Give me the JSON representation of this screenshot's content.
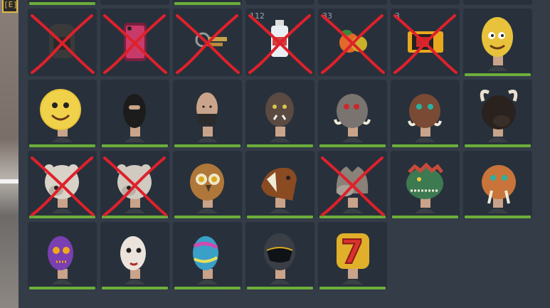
{
  "key_hint": "[E]",
  "inventory": {
    "slots": [
      {
        "kind": "unknown",
        "icon": "unknown-item-icon",
        "count": "",
        "crossed": false,
        "bar": true
      },
      {
        "kind": "unknown",
        "icon": "unknown-item-icon",
        "count": "",
        "crossed": false,
        "bar": false
      },
      {
        "kind": "unknown",
        "icon": "unknown-item-icon",
        "count": "",
        "crossed": false,
        "bar": true
      },
      {
        "kind": "unknown",
        "icon": "unknown-item-icon",
        "count": "",
        "crossed": false,
        "bar": false
      },
      {
        "kind": "unknown",
        "icon": "unknown-item-icon",
        "count": "",
        "crossed": false,
        "bar": false
      },
      {
        "kind": "unknown",
        "icon": "unknown-item-icon",
        "count": "",
        "crossed": false,
        "bar": false
      },
      {
        "kind": "unknown",
        "icon": "unknown-item-icon",
        "count": "",
        "crossed": false,
        "bar": false
      },
      {
        "kind": "backpack",
        "icon": "backpack-icon",
        "count": "",
        "crossed": true,
        "bar": false
      },
      {
        "kind": "phone",
        "icon": "phone-icon",
        "count": "",
        "crossed": true,
        "bar": false
      },
      {
        "kind": "keys",
        "icon": "keys-icon",
        "count": "",
        "crossed": true,
        "bar": false
      },
      {
        "kind": "bottle",
        "icon": "water-bottle-icon",
        "count": "112",
        "crossed": true,
        "bar": false
      },
      {
        "kind": "fruit",
        "icon": "fruit-icon",
        "count": "33",
        "crossed": true,
        "bar": false
      },
      {
        "kind": "ticket",
        "icon": "ticket-icon",
        "count": "3",
        "crossed": true,
        "bar": false
      },
      {
        "kind": "mask",
        "icon": "pineapple-mask-icon",
        "color": "#e7c23a",
        "count": "",
        "crossed": false,
        "bar": true
      },
      {
        "kind": "mask",
        "icon": "lemon-face-mask-icon",
        "color": "#f0d24a",
        "count": "",
        "crossed": false,
        "bar": true
      },
      {
        "kind": "mask",
        "icon": "balaclava-mask-icon",
        "color": "#1c1c1c",
        "count": "",
        "crossed": false,
        "bar": true
      },
      {
        "kind": "mask",
        "icon": "bandana-mask-icon",
        "color": "#2b2b2b",
        "count": "",
        "crossed": false,
        "bar": true
      },
      {
        "kind": "mask",
        "icon": "orc-mask-icon",
        "color": "#5a4a42",
        "count": "",
        "crossed": false,
        "bar": true
      },
      {
        "kind": "mask",
        "icon": "warthog-mask-icon",
        "color": "#7a7470",
        "count": "",
        "crossed": false,
        "bar": true
      },
      {
        "kind": "mask",
        "icon": "boar-mask-icon",
        "color": "#7a4a35",
        "count": "",
        "crossed": false,
        "bar": true
      },
      {
        "kind": "mask",
        "icon": "bull-mask-icon",
        "color": "#2a221e",
        "count": "",
        "crossed": false,
        "bar": true
      },
      {
        "kind": "mask",
        "icon": "bear-mask-icon",
        "color": "#d8d2c8",
        "count": "",
        "crossed": true,
        "bar": true
      },
      {
        "kind": "mask",
        "icon": "bear-mask-icon",
        "color": "#d0cac0",
        "count": "",
        "crossed": true,
        "bar": true
      },
      {
        "kind": "mask",
        "icon": "owl-mask-icon",
        "color": "#b0773a",
        "count": "",
        "crossed": false,
        "bar": true
      },
      {
        "kind": "mask",
        "icon": "horse-mask-icon",
        "color": "#8a4a22",
        "count": "",
        "crossed": false,
        "bar": true
      },
      {
        "kind": "mask",
        "icon": "wolf-mask-icon",
        "color": "#8a8178",
        "count": "",
        "crossed": true,
        "bar": true
      },
      {
        "kind": "mask",
        "icon": "dinosaur-mask-icon",
        "color": "#3d7a52",
        "count": "",
        "crossed": false,
        "bar": true
      },
      {
        "kind": "mask",
        "icon": "walrus-mask-icon",
        "color": "#c8743a",
        "count": "",
        "crossed": false,
        "bar": true
      },
      {
        "kind": "mask",
        "icon": "purple-skull-mask-icon",
        "color": "#7a3fb0",
        "count": "",
        "crossed": false,
        "bar": true
      },
      {
        "kind": "mask",
        "icon": "doll-mask-icon",
        "color": "#ece4dc",
        "count": "",
        "crossed": false,
        "bar": true
      },
      {
        "kind": "mask",
        "icon": "tie-dye-mask-icon",
        "color": "#3aa0c8",
        "count": "",
        "crossed": false,
        "bar": true
      },
      {
        "kind": "mask",
        "icon": "visor-helmet-mask-icon",
        "color": "#3a3e46",
        "count": "",
        "crossed": false,
        "bar": true
      },
      {
        "kind": "mask",
        "icon": "lucky-seven-mask-icon",
        "color": "#d8322e",
        "count": "",
        "crossed": false,
        "bar": true
      },
      {
        "kind": "empty",
        "icon": "",
        "count": "",
        "crossed": false,
        "bar": false
      },
      {
        "kind": "empty",
        "icon": "",
        "count": "",
        "crossed": false,
        "bar": false
      }
    ]
  },
  "colors": {
    "panel": "#333c47",
    "slot": "#28313b",
    "durability_bar": "#6cae3a",
    "cross": "#e0202a",
    "skin": "#c9a38a"
  }
}
